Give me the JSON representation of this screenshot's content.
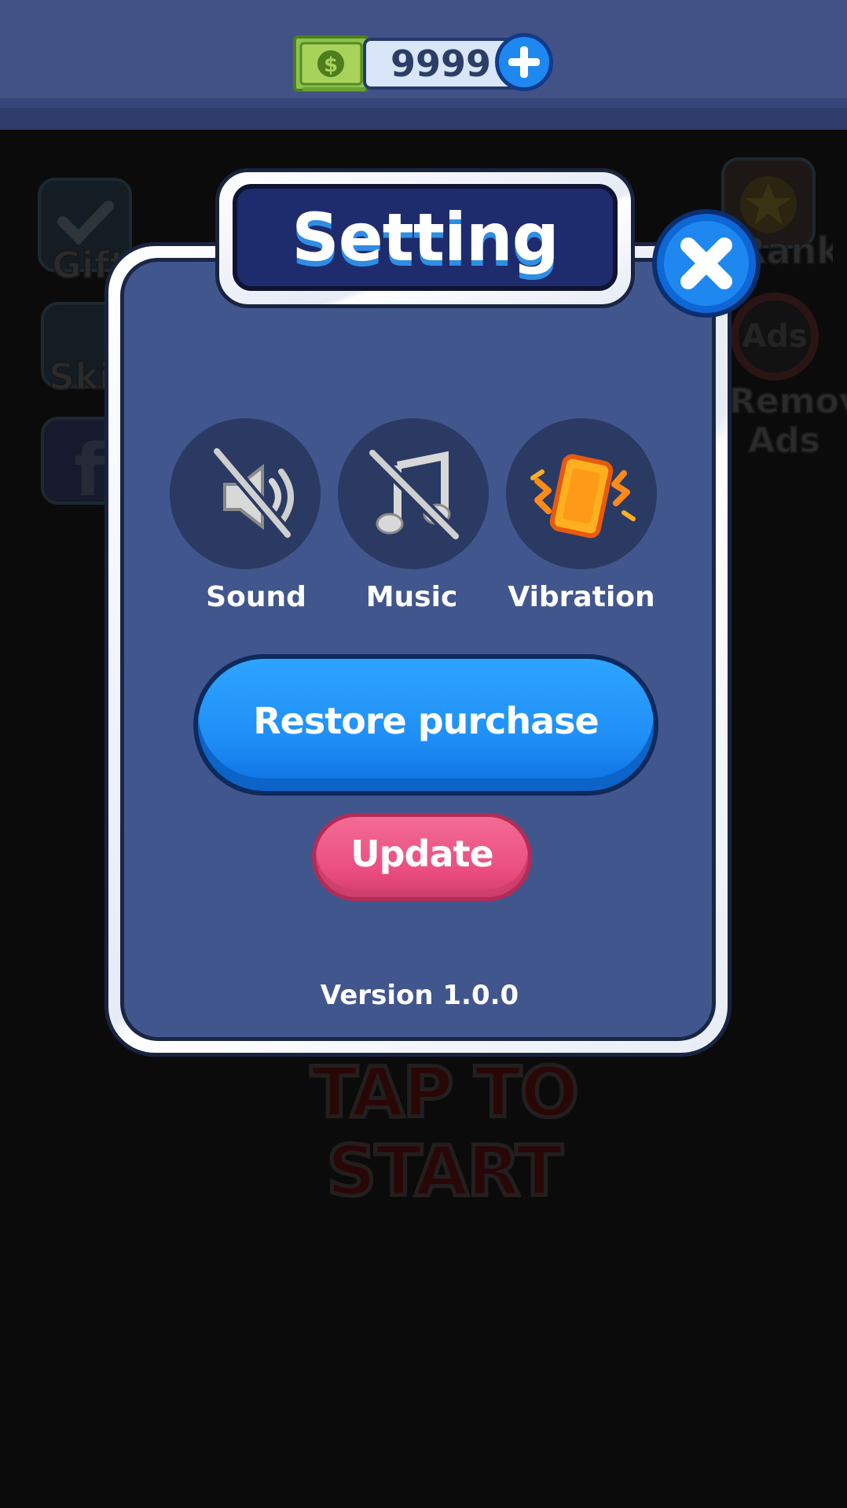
{
  "currency": {
    "amount": "9999",
    "icon": "cash-icon",
    "add_icon": "plus-icon"
  },
  "background": {
    "side_buttons": [
      {
        "label": "Gift",
        "icon": "check-icon"
      },
      {
        "label": "Skin",
        "icon": "skin-icon"
      },
      {
        "label": "",
        "icon": "facebook-icon"
      }
    ],
    "right_buttons": [
      {
        "label": "Rank",
        "icon": "trophy-icon"
      },
      {
        "label": "Remove Ads",
        "icon": "no-ads-icon",
        "badge": "Ads"
      }
    ],
    "tap_to_start": "TAP TO START"
  },
  "dialog": {
    "title": "Setting",
    "close_icon": "close-icon",
    "toggles": [
      {
        "label": "Sound",
        "icon": "sound-off-icon",
        "enabled": false
      },
      {
        "label": "Music",
        "icon": "music-off-icon",
        "enabled": false
      },
      {
        "label": "Vibration",
        "icon": "vibration-icon",
        "enabled": true
      }
    ],
    "restore_label": "Restore purchase",
    "update_label": "Update",
    "version": "Version 1.0.0"
  },
  "colors": {
    "panel": "#42568e",
    "primary_button": "#1f8ff7",
    "secondary_button": "#ea4f80",
    "cash": "#8bc34a",
    "vibration": "#ff9f1a"
  }
}
